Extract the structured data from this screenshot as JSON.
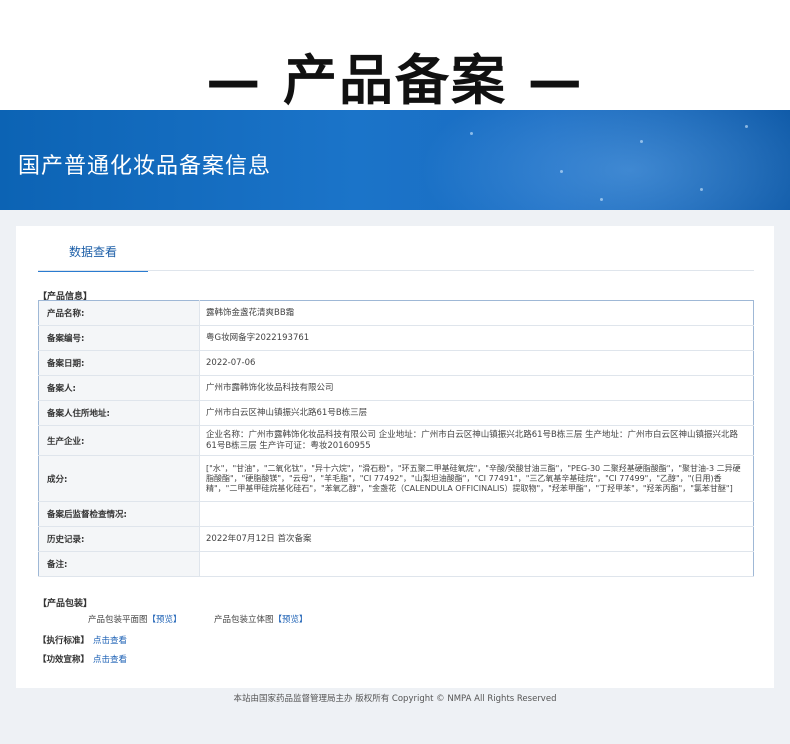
{
  "heading": "— 产品备案 —",
  "banner": {
    "title": "国产普通化妆品备案信息"
  },
  "tab": {
    "label": "数据查看"
  },
  "product_info": {
    "section_label": "【产品信息】",
    "rows": [
      {
        "label": "产品名称:",
        "value": "露韩饰金盏花清爽BB霜"
      },
      {
        "label": "备案编号:",
        "value": "粤G妆网备字2022193761"
      },
      {
        "label": "备案日期:",
        "value": "2022-07-06"
      },
      {
        "label": "备案人:",
        "value": "广州市露韩饰化妆品科技有限公司"
      },
      {
        "label": "备案人住所地址:",
        "value": "广州市白云区神山镇振兴北路61号B栋三层"
      },
      {
        "label": "生产企业:",
        "value": "企业名称：广州市露韩饰化妆品科技有限公司 企业地址：广州市白云区神山镇振兴北路61号B栋三层 生产地址：广州市白云区神山镇振兴北路61号B栋三层 生产许可证：粤妆20160955"
      },
      {
        "label": "成分:",
        "value": "[\"水\"，\"甘油\"，\"二氧化钛\"，\"异十六烷\"，\"滑石粉\"，\"环五聚二甲基硅氧烷\"，\"辛酸/癸酸甘油三酯\"，\"PEG-30 二聚羟基硬脂酸酯\"，\"聚甘油-3 二异硬脂酸酯\"，\"硬脂酸镁\"，\"云母\"，\"羊毛脂\"，\"CI 77492\"，\"山梨坦油酸酯\"，\"CI 77491\"，\"三乙氧基辛基硅烷\"，\"CI 77499\"，\"乙醇\"，\"(日用)香精\"，\"二甲基甲硅烷基化硅石\"，\"苯氧乙醇\"，\"金盏花（CALENDULA OFFICINALIS）提取物\"，\"羟苯甲酯\"，\"丁羟甲苯\"，\"羟苯丙酯\"，\"氯苯甘醚\"]"
      },
      {
        "label": "备案后监督检查情况:",
        "value": ""
      },
      {
        "label": "历史记录:",
        "value": "2022年07月12日 首次备案"
      },
      {
        "label": "备注:",
        "value": ""
      }
    ]
  },
  "packaging": {
    "section_label": "【产品包装】",
    "items": [
      {
        "label": "产品包装平面图",
        "link": "【预览】"
      },
      {
        "label": "产品包装立体图",
        "link": "【预览】"
      }
    ]
  },
  "standards": {
    "label": "【执行标准】",
    "link": "点击查看"
  },
  "efficacy": {
    "label": "【功效宣称】",
    "link": "点击查看"
  },
  "footer": {
    "text": "本站由国家药品监督管理局主办 版权所有 Copyright © NMPA All Rights Reserved"
  },
  "colors": {
    "banner": "#1a6cc2",
    "link": "#1a5fb4",
    "tab_accent": "#2a7bd0"
  }
}
